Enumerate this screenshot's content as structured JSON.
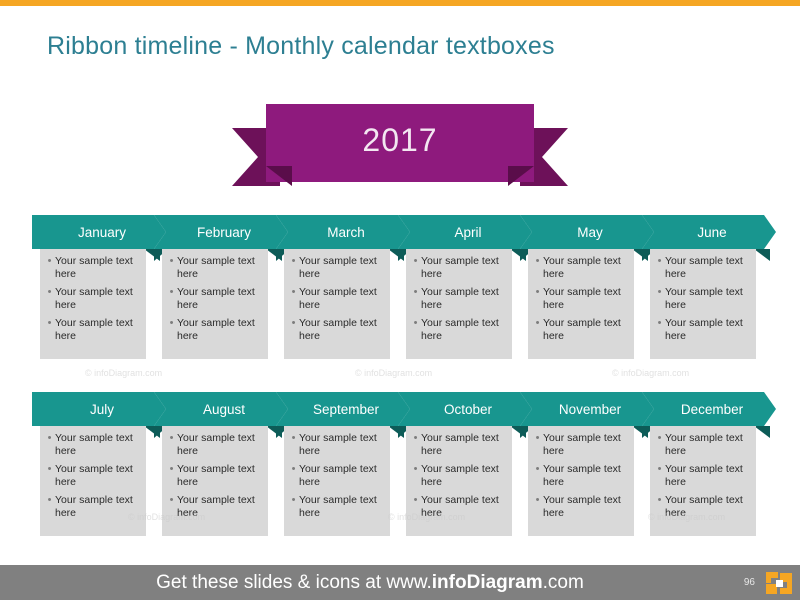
{
  "slide": {
    "title": "Ribbon timeline - Monthly calendar textboxes",
    "top_accent_color": "#f5a623",
    "title_color": "#2d7f92"
  },
  "ribbon": {
    "year": "2017",
    "fill_color": "#8e1a7d",
    "tail_color": "#6d1159",
    "fold_color": "#5a0d4a"
  },
  "palette": {
    "header_teal": "#18968f",
    "header_shadow": "#0d5c58",
    "body_gray": "#d9d9d9",
    "footer_gray": "#808080",
    "accent_orange": "#f5a623"
  },
  "months": [
    {
      "name": "January",
      "items": [
        "Your sample text here",
        "Your sample text here",
        "Your sample text here"
      ]
    },
    {
      "name": "February",
      "items": [
        "Your sample text here",
        "Your sample text here",
        "Your sample text here"
      ]
    },
    {
      "name": "March",
      "items": [
        "Your sample text here",
        "Your sample text here",
        "Your sample text here"
      ]
    },
    {
      "name": "April",
      "items": [
        "Your sample text here",
        "Your sample text here",
        "Your sample text here"
      ]
    },
    {
      "name": "May",
      "items": [
        "Your sample text here",
        "Your sample text here",
        "Your sample text here"
      ]
    },
    {
      "name": "June",
      "items": [
        "Your sample text here",
        "Your sample text here",
        "Your sample text here"
      ]
    },
    {
      "name": "July",
      "items": [
        "Your sample text here",
        "Your sample text here",
        "Your sample text here"
      ]
    },
    {
      "name": "August",
      "items": [
        "Your sample text here",
        "Your sample text here",
        "Your sample text here"
      ]
    },
    {
      "name": "September",
      "items": [
        "Your sample text here",
        "Your sample text here",
        "Your sample text here"
      ]
    },
    {
      "name": "October",
      "items": [
        "Your sample text here",
        "Your sample text here",
        "Your sample text here"
      ]
    },
    {
      "name": "November",
      "items": [
        "Your sample text here",
        "Your sample text here",
        "Your sample text here"
      ]
    },
    {
      "name": "December",
      "items": [
        "Your sample text here",
        "Your sample text here",
        "Your sample text here"
      ]
    }
  ],
  "bullet_glyph": "•",
  "watermark": {
    "text": "© infoDiagram.com"
  },
  "footer": {
    "text_prefix": "Get these slides & icons at www.",
    "text_brand": "infoDiagram",
    "text_suffix": ".com",
    "page_number": "96",
    "logo_name": "infodiagram-logo"
  }
}
